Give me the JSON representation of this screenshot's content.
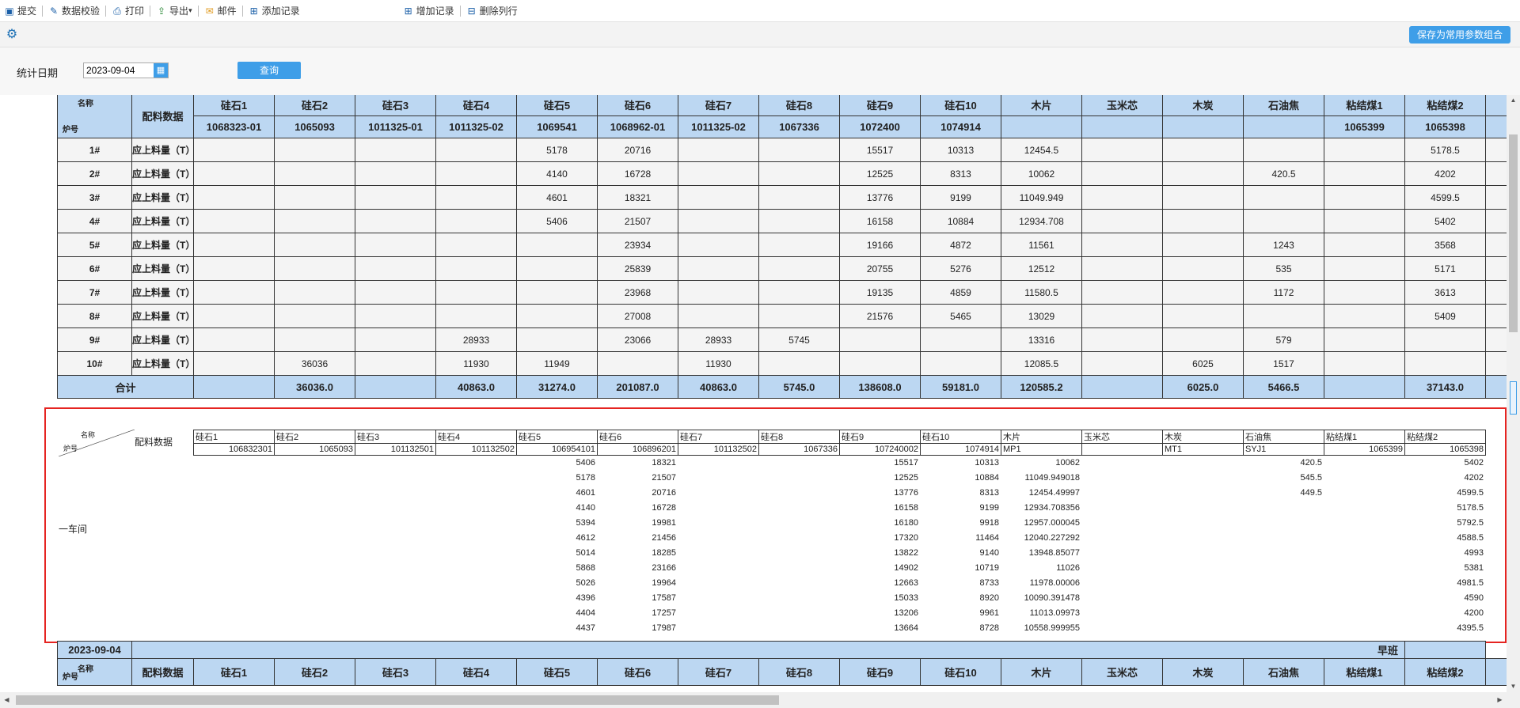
{
  "toolbar": {
    "items": [
      {
        "label": "提交",
        "icon": "submit-icon"
      },
      {
        "label": "数据校验",
        "icon": "check-icon"
      },
      {
        "label": "打印",
        "icon": "print-icon"
      },
      {
        "label": "导出",
        "icon": "export-icon"
      },
      {
        "label": "邮件",
        "icon": "mail-icon"
      },
      {
        "label": "添加记录",
        "icon": "add-record-icon"
      },
      {
        "label": "增加记录",
        "icon": "insert-record-icon"
      },
      {
        "label": "删除列行",
        "icon": "delete-row-icon"
      }
    ],
    "save_combo_label": "保存为常用参数组合"
  },
  "filter": {
    "date_label": "统计日期",
    "date_value": "2023-09-04",
    "query_label": "查询"
  },
  "report": {
    "corner_name": "名称",
    "corner_furnace": "炉号",
    "peiliao_label": "配料数据",
    "columns": [
      "硅石1",
      "硅石2",
      "硅石3",
      "硅石4",
      "硅石5",
      "硅石6",
      "硅石7",
      "硅石8",
      "硅石9",
      "硅石10",
      "木片",
      "玉米芯",
      "木炭",
      "石油焦",
      "粘结煤1",
      "粘结煤2"
    ],
    "codes": [
      "1068323-01",
      "1065093",
      "1011325-01",
      "1011325-02",
      "1069541",
      "1068962-01",
      "1011325-02",
      "1067336",
      "1072400",
      "1074914",
      "",
      "",
      "",
      "",
      "1065399",
      "1065398"
    ],
    "row_label": "应上料量（T）",
    "rows": [
      {
        "furnace": "1#",
        "values": [
          "",
          "",
          "",
          "",
          "5178",
          "20716",
          "",
          "",
          "15517",
          "10313",
          "12454.5",
          "",
          "",
          "",
          "",
          "5178.5"
        ]
      },
      {
        "furnace": "2#",
        "values": [
          "",
          "",
          "",
          "",
          "4140",
          "16728",
          "",
          "",
          "12525",
          "8313",
          "10062",
          "",
          "",
          "420.5",
          "",
          "4202"
        ]
      },
      {
        "furnace": "3#",
        "values": [
          "",
          "",
          "",
          "",
          "4601",
          "18321",
          "",
          "",
          "13776",
          "9199",
          "11049.949",
          "",
          "",
          "",
          "",
          "4599.5"
        ]
      },
      {
        "furnace": "4#",
        "values": [
          "",
          "",
          "",
          "",
          "5406",
          "21507",
          "",
          "",
          "16158",
          "10884",
          "12934.708",
          "",
          "",
          "",
          "",
          "5402"
        ]
      },
      {
        "furnace": "5#",
        "values": [
          "",
          "",
          "",
          "",
          "",
          "23934",
          "",
          "",
          "19166",
          "4872",
          "11561",
          "",
          "",
          "1243",
          "",
          "3568"
        ]
      },
      {
        "furnace": "6#",
        "values": [
          "",
          "",
          "",
          "",
          "",
          "25839",
          "",
          "",
          "20755",
          "5276",
          "12512",
          "",
          "",
          "535",
          "",
          "5171"
        ]
      },
      {
        "furnace": "7#",
        "values": [
          "",
          "",
          "",
          "",
          "",
          "23968",
          "",
          "",
          "19135",
          "4859",
          "11580.5",
          "",
          "",
          "1172",
          "",
          "3613"
        ]
      },
      {
        "furnace": "8#",
        "values": [
          "",
          "",
          "",
          "",
          "",
          "27008",
          "",
          "",
          "21576",
          "5465",
          "13029",
          "",
          "",
          "",
          "",
          "5409"
        ]
      },
      {
        "furnace": "9#",
        "values": [
          "",
          "",
          "",
          "28933",
          "",
          "23066",
          "28933",
          "5745",
          "",
          "",
          "13316",
          "",
          "",
          "579",
          "",
          ""
        ]
      },
      {
        "furnace": "10#",
        "values": [
          "",
          "36036",
          "",
          "11930",
          "11949",
          "",
          "11930",
          "",
          "",
          "",
          "12085.5",
          "",
          "6025",
          "1517",
          "",
          ""
        ]
      }
    ],
    "total_label": "合计",
    "totals": [
      "",
      "36036.0",
      "",
      "40863.0",
      "31274.0",
      "201087.0",
      "40863.0",
      "5745.0",
      "138608.0",
      "59181.0",
      "120585.2",
      "",
      "6025.0",
      "5466.5",
      "",
      "37143.0"
    ]
  },
  "panel": {
    "corner_name": "名称",
    "corner_furnace": "炉号",
    "peiliao_label": "配料数据",
    "workshop": "一车间",
    "columns": [
      "硅石1",
      "硅石2",
      "硅石3",
      "硅石4",
      "硅石5",
      "硅石6",
      "硅石7",
      "硅石8",
      "硅石9",
      "硅石10",
      "木片",
      "玉米芯",
      "木炭",
      "石油焦",
      "粘结煤1",
      "粘结煤2"
    ],
    "codes": [
      "106832301",
      "1065093",
      "101132501",
      "101132502",
      "106954101",
      "106896201",
      "101132502",
      "1067336",
      "107240002",
      "1074914",
      "MP1",
      "",
      "MT1",
      "SYJ1",
      "1065399",
      "1065398"
    ],
    "rows": [
      [
        "",
        "",
        "",
        "",
        "5406",
        "18321",
        "",
        "",
        "15517",
        "10313",
        "10062",
        "",
        "",
        "420.5",
        "",
        "5402"
      ],
      [
        "",
        "",
        "",
        "",
        "5178",
        "21507",
        "",
        "",
        "12525",
        "10884",
        "11049.949018",
        "",
        "",
        "545.5",
        "",
        "4202"
      ],
      [
        "",
        "",
        "",
        "",
        "4601",
        "20716",
        "",
        "",
        "13776",
        "8313",
        "12454.49997",
        "",
        "",
        "449.5",
        "",
        "4599.5"
      ],
      [
        "",
        "",
        "",
        "",
        "4140",
        "16728",
        "",
        "",
        "16158",
        "9199",
        "12934.708356",
        "",
        "",
        "",
        "",
        "5178.5"
      ],
      [
        "",
        "",
        "",
        "",
        "5394",
        "19981",
        "",
        "",
        "16180",
        "9918",
        "12957.000045",
        "",
        "",
        "",
        "",
        "5792.5"
      ],
      [
        "",
        "",
        "",
        "",
        "4612",
        "21456",
        "",
        "",
        "17320",
        "11464",
        "12040.227292",
        "",
        "",
        "",
        "",
        "4588.5"
      ],
      [
        "",
        "",
        "",
        "",
        "5014",
        "18285",
        "",
        "",
        "13822",
        "9140",
        "13948.85077",
        "",
        "",
        "",
        "",
        "4993"
      ],
      [
        "",
        "",
        "",
        "",
        "5868",
        "23166",
        "",
        "",
        "14902",
        "10719",
        "11026",
        "",
        "",
        "",
        "",
        "5381"
      ],
      [
        "",
        "",
        "",
        "",
        "5026",
        "19964",
        "",
        "",
        "12663",
        "8733",
        "11978.00006",
        "",
        "",
        "",
        "",
        "4981.5"
      ],
      [
        "",
        "",
        "",
        "",
        "4396",
        "17587",
        "",
        "",
        "15033",
        "8920",
        "10090.391478",
        "",
        "",
        "",
        "",
        "4590"
      ],
      [
        "",
        "",
        "",
        "",
        "4404",
        "17257",
        "",
        "",
        "13206",
        "9961",
        "11013.09973",
        "",
        "",
        "",
        "",
        "4200"
      ],
      [
        "",
        "",
        "",
        "",
        "4437",
        "17987",
        "",
        "",
        "13664",
        "8728",
        "10558.999955",
        "",
        "",
        "",
        "",
        "4395.5"
      ]
    ]
  },
  "section2": {
    "date": "2023-09-04",
    "shift": "早班"
  }
}
